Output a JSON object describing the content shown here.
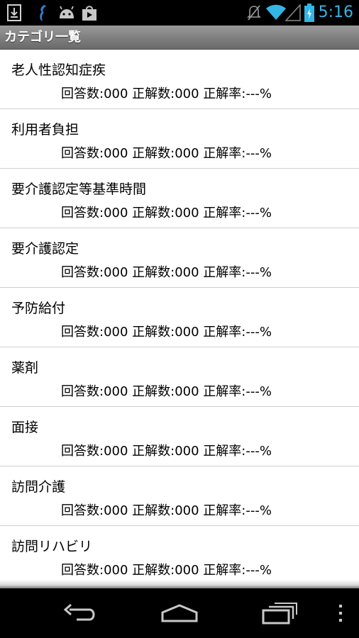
{
  "status_bar": {
    "time": "5:16",
    "icons": [
      "download-icon",
      "notification-app-icon",
      "android-icon",
      "store-bag-icon",
      "mute-icon",
      "wifi-icon",
      "signal-icon",
      "battery-charging-icon"
    ],
    "accent_color": "#33b5e5"
  },
  "title_bar": {
    "title": "カテゴリ一覧"
  },
  "categories": [
    {
      "name": "老人性認知症疾",
      "stats": "回答数:000 正解数:000 正解率:---%"
    },
    {
      "name": "利用者負担",
      "stats": "回答数:000 正解数:000 正解率:---%"
    },
    {
      "name": "要介護認定等基準時間",
      "stats": "回答数:000 正解数:000 正解率:---%"
    },
    {
      "name": "要介護認定",
      "stats": "回答数:000 正解数:000 正解率:---%"
    },
    {
      "name": "予防給付",
      "stats": "回答数:000 正解数:000 正解率:---%"
    },
    {
      "name": "薬剤",
      "stats": "回答数:000 正解数:000 正解率:---%"
    },
    {
      "name": "面接",
      "stats": "回答数:000 正解数:000 正解率:---%"
    },
    {
      "name": "訪問介護",
      "stats": "回答数:000 正解数:000 正解率:---%"
    },
    {
      "name": "訪問リハビリ",
      "stats": "回答数:000 正解数:000 正解率:---%"
    }
  ],
  "nav_bar": {
    "buttons": [
      "back-icon",
      "home-icon",
      "recent-apps-icon",
      "menu-icon"
    ]
  }
}
